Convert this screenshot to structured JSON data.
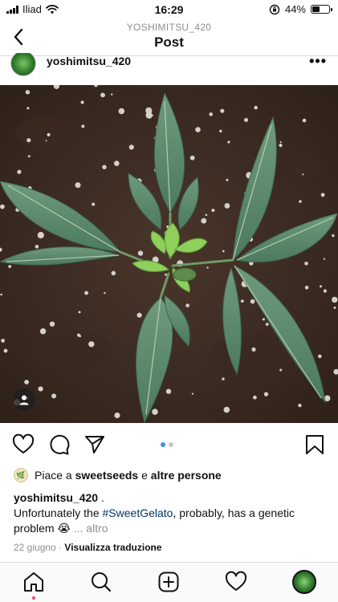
{
  "status_bar": {
    "carrier": "Iliad",
    "time": "16:29",
    "battery": "44%",
    "battery_level": 0.44
  },
  "nav": {
    "username": "YOSHIMITSU_420",
    "title": "Post"
  },
  "post": {
    "username": "yoshimitsu_420",
    "more": "•••",
    "carousel": {
      "count": 2,
      "active": 1
    }
  },
  "likes": {
    "prefix": "Piace a",
    "user": "sweetseeds",
    "join": "e",
    "others": "altre persone"
  },
  "caption": {
    "username": "yoshimitsu_420",
    "after_user": ".",
    "text_before": "Unfortunately the",
    "hashtag": "#SweetGelato",
    "text_after": ", probably, has a genetic problem",
    "emoji": "😭",
    "more": "... altro"
  },
  "meta": {
    "date": "22 giugno",
    "separator": "·",
    "translate": "Visualizza traduzione"
  },
  "icons": {
    "back": "chevron-left-icon",
    "like": "heart-icon",
    "comment": "comment-icon",
    "share": "send-icon",
    "save": "bookmark-icon",
    "tag": "person-icon",
    "home": "home-icon",
    "search": "search-icon",
    "new_post": "plus-square-icon",
    "activity": "heart-icon",
    "profile": "avatar"
  },
  "colors": {
    "link": "#003569",
    "muted": "#8e8e8e",
    "active_dot": "#3897f0",
    "notification": "#ed4956"
  }
}
